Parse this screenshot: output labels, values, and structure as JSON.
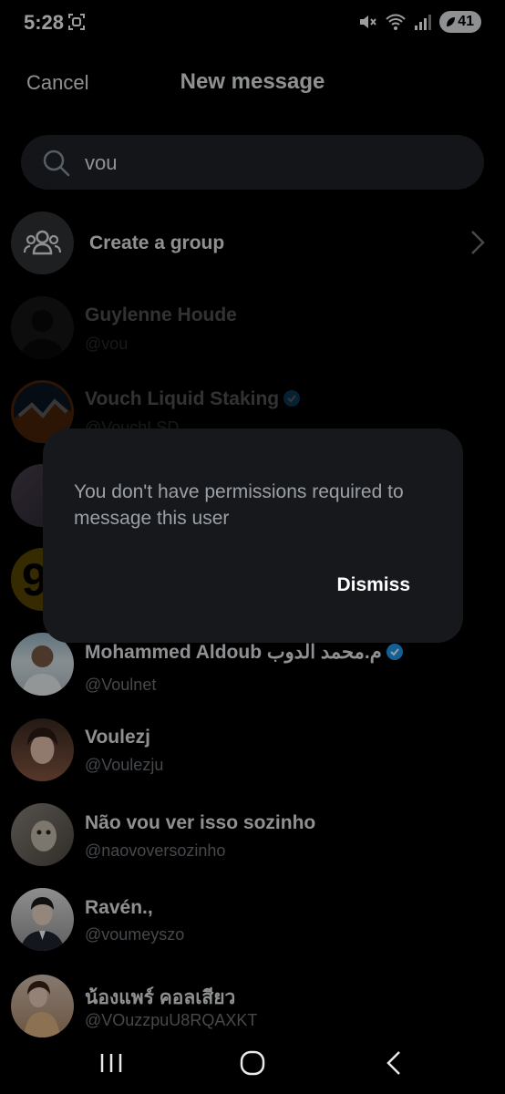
{
  "status_bar": {
    "time": "5:28",
    "battery": "41"
  },
  "header": {
    "cancel_label": "Cancel",
    "title": "New message"
  },
  "search": {
    "value": "vou"
  },
  "create_group": {
    "label": "Create a group"
  },
  "results": [
    {
      "name": "Guylenne Houde",
      "handle": "@vou",
      "verified": false
    },
    {
      "name": "Vouch Liquid Staking",
      "handle": "@VouchLSD",
      "verified": true
    },
    {
      "name": "",
      "handle": "",
      "verified": false
    },
    {
      "name": "",
      "handle": "",
      "verified": false
    },
    {
      "name": "Mohammed Aldoub م.محمد الدوب",
      "handle": "@Voulnet",
      "verified": true
    },
    {
      "name": "Voulezj",
      "handle": "@Voulezju",
      "verified": false
    },
    {
      "name": "Não vou ver isso sozinho",
      "handle": "@naovoversozinho",
      "verified": false
    },
    {
      "name": "Ravén.,",
      "handle": "@voumeyszo",
      "verified": false
    },
    {
      "name": "น้องแพร์ คอลเสียว",
      "handle": "@VOuzzpuU8RQAXKT",
      "verified": false
    }
  ],
  "dialog": {
    "message": "You don't have permissions required to message this user",
    "dismiss_label": "Dismiss"
  },
  "colors": {
    "background": "#000000",
    "accent": "#1d9bf0",
    "dialog": "#16181c"
  }
}
